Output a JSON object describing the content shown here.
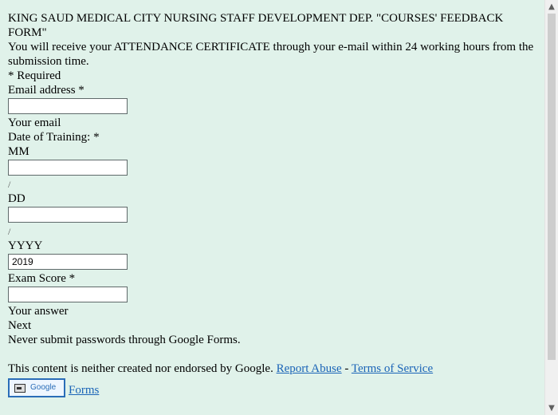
{
  "form": {
    "title": "KING SAUD MEDICAL CITY NURSING STAFF DEVELOPMENT DEP. \"COURSES' FEEDBACK FORM\"",
    "description": "You will receive your ATTENDANCE CERTIFICATE through your e-mail within 24 working hours from the submission time.",
    "required_note": "* Required",
    "email": {
      "label": "Email address *",
      "value": "",
      "hint": "Your email"
    },
    "date": {
      "label": "Date of Training: *",
      "mm": {
        "label": "MM",
        "value": ""
      },
      "slash1": "/",
      "dd": {
        "label": "DD",
        "value": ""
      },
      "slash2": "/",
      "yyyy": {
        "label": "YYYY",
        "value": "2019"
      }
    },
    "exam": {
      "label": "Exam Score *",
      "value": "",
      "hint": "Your answer"
    },
    "next_label": "Next",
    "password_warning": "Never submit passwords through Google Forms."
  },
  "footer": {
    "disclaimer": "This content is neither created nor endorsed by Google.",
    "report_abuse": "Report Abuse",
    "separator": "-",
    "terms": "Terms of Service",
    "google_button": "Google",
    "forms_link": "Forms"
  },
  "scrollbar": {
    "up_icon": "scroll-up-arrow",
    "down_icon": "scroll-down-arrow"
  }
}
